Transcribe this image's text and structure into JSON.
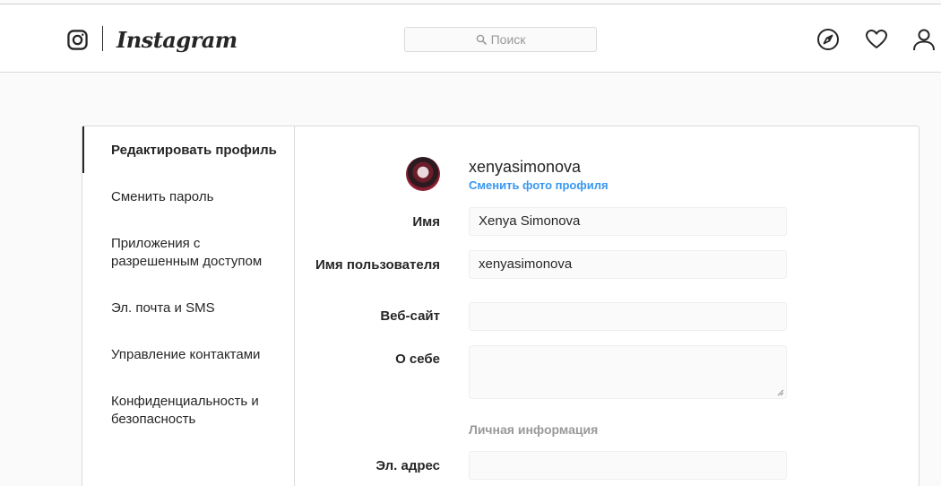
{
  "header": {
    "brand": "Instagram",
    "search_placeholder": "Поиск"
  },
  "sidebar": {
    "items": [
      {
        "label": "Редактировать профиль",
        "active": true
      },
      {
        "label": "Сменить пароль"
      },
      {
        "label": "Приложения с разрешенным доступом"
      },
      {
        "label": "Эл. почта и SMS"
      },
      {
        "label": "Управление контактами"
      },
      {
        "label": "Конфиденциальность и безопасность"
      }
    ]
  },
  "profile": {
    "username": "xenyasimonova",
    "change_photo": "Сменить фото профиля"
  },
  "form": {
    "name_label": "Имя",
    "name_value": "Xenya Simonova",
    "username_label": "Имя пользователя",
    "username_value": "xenyasimonova",
    "website_label": "Веб-сайт",
    "website_value": "",
    "bio_label": "О себе",
    "bio_value": "",
    "personal_info_title": "Личная информация",
    "email_label": "Эл. адрес",
    "email_value": ""
  },
  "colors": {
    "link": "#3897f0",
    "border": "#dbdbdb",
    "text": "#262626",
    "muted": "#999999"
  }
}
